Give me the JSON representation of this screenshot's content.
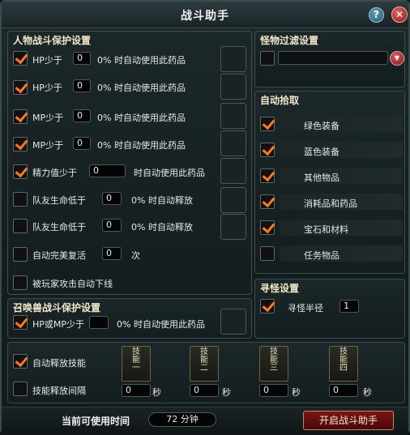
{
  "title": "战斗助手",
  "title_buttons": {
    "help": "?",
    "close": "✕"
  },
  "player_section": {
    "title": "人物战斗保护设置",
    "rows": [
      {
        "checked": true,
        "prefix": "HP少于",
        "value": "0",
        "suffix": "0% 时自动使用此药品"
      },
      {
        "checked": true,
        "prefix": "HP少于",
        "value": "0",
        "suffix": "0% 时自动使用此药品"
      },
      {
        "checked": true,
        "prefix": "MP少于",
        "value": "0",
        "suffix": "0% 时自动使用此药品"
      },
      {
        "checked": true,
        "prefix": "MP少于",
        "value": "0",
        "suffix": "0% 时自动使用此药品"
      },
      {
        "checked": true,
        "prefix": "精力值少于",
        "value": "0",
        "suffix": "时自动使用此药品"
      },
      {
        "checked": false,
        "prefix": "队友生命低于",
        "value": "0",
        "suffix": "0% 时自动释放"
      },
      {
        "checked": false,
        "prefix": "队友生命低于",
        "value": "0",
        "suffix": "0% 时自动释放"
      }
    ],
    "revive": {
      "checked": false,
      "label": "自动完美复活",
      "value": "0",
      "unit": "次"
    },
    "attacked": {
      "checked": false,
      "label": "被玩家攻击自动下线"
    }
  },
  "pet_section": {
    "title": "召唤兽战斗保护设置",
    "row": {
      "checked": true,
      "prefix": "HP或MP少于",
      "value": "",
      "suffix": "0% 时自动使用此药品"
    }
  },
  "monster_filter": {
    "title": "怪物过滤设置",
    "checked": false,
    "selected": ""
  },
  "auto_pickup": {
    "title": "自动拾取",
    "items": [
      {
        "checked": true,
        "label": "绿色装备"
      },
      {
        "checked": true,
        "label": "蓝色装备"
      },
      {
        "checked": true,
        "label": "其他物品"
      },
      {
        "checked": true,
        "label": "消耗品和药品"
      },
      {
        "checked": true,
        "label": "宝石和材料"
      },
      {
        "checked": false,
        "label": "任务物品"
      }
    ]
  },
  "seek_monster": {
    "title": "寻怪设置",
    "checked": true,
    "label": "寻怪半径",
    "value": "1"
  },
  "skills": {
    "auto_release": {
      "checked": true,
      "label": "自动释放技能"
    },
    "interval": {
      "checked": false,
      "label": "技能释放间隔"
    },
    "slots": [
      {
        "label": "技能一",
        "value": "0",
        "unit": "秒"
      },
      {
        "label": "技能二",
        "value": "0",
        "unit": "秒"
      },
      {
        "label": "技能三",
        "value": "0",
        "unit": "秒"
      },
      {
        "label": "技能四",
        "value": "0",
        "unit": "秒"
      }
    ]
  },
  "footer": {
    "time_label": "当前可使用时间",
    "time_value": "72 分钟",
    "start_button": "开启战斗助手"
  }
}
